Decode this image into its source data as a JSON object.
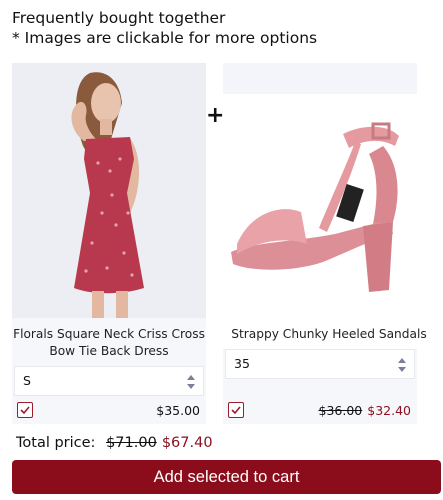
{
  "heading": {
    "line1": "Frequently bought together",
    "line2": "* Images are clickable for more options"
  },
  "plus_sign": "+",
  "products": [
    {
      "name": "Florals Square Neck Criss Cross Bow Tie Back Dress",
      "selected_option": "S",
      "checked": true,
      "price": "$35.00"
    },
    {
      "name": "Strappy Chunky Heeled Sandals",
      "selected_option": "35",
      "checked": true,
      "old_price": "$36.00",
      "price": "$32.40"
    }
  ],
  "total": {
    "label": "Total price:",
    "old_price": "$71.00",
    "price": "$67.40"
  },
  "cart_button": "Add selected to cart",
  "colors": {
    "accent": "#8b0d1b",
    "sale_price": "#8b1221",
    "card_bg": "#f6f7fb"
  }
}
